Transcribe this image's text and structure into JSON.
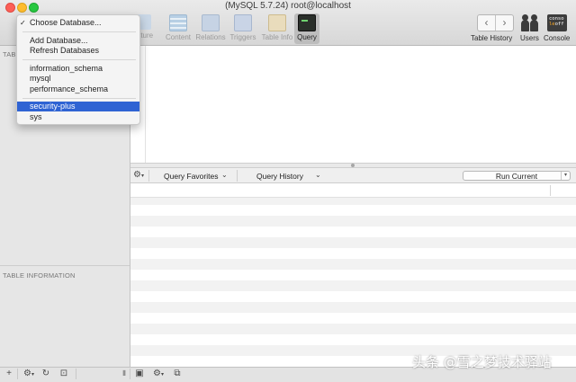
{
  "window": {
    "title": "(MySQL 5.7.24) root@localhost"
  },
  "toolbar": {
    "items": [
      {
        "label": "Structure",
        "visible_label": "ucture",
        "icon": "structure-icon",
        "active": false
      },
      {
        "label": "Content",
        "icon": "content-icon",
        "active": false
      },
      {
        "label": "Relations",
        "icon": "relations-icon",
        "active": false
      },
      {
        "label": "Triggers",
        "icon": "triggers-icon",
        "active": false
      },
      {
        "label": "Table Info",
        "icon": "table-info-icon",
        "active": false
      },
      {
        "label": "Query",
        "icon": "query-icon",
        "active": true
      }
    ],
    "history_label": "Table History",
    "users_label": "Users",
    "console_label": "Console",
    "console_icon_text": [
      "conso",
      "le",
      "off"
    ]
  },
  "sidebar": {
    "tables_header": "TABLE",
    "table_info_header": "TABLE INFORMATION"
  },
  "db_menu": {
    "choose": "Choose Database...",
    "add": "Add Database...",
    "refresh": "Refresh Databases",
    "databases": [
      "information_schema",
      "mysql",
      "performance_schema"
    ],
    "user_databases": [
      "security-plus",
      "sys"
    ],
    "selected": "security-plus",
    "check_glyph": "✓"
  },
  "query_bar": {
    "favorites": "Query Favorites",
    "history": "Query History",
    "run": "Run Current",
    "chevron": "⌄"
  },
  "watermark": "头条 @雪之梦技术驿站",
  "colors": {
    "selection": "#2f63d3",
    "window_bg": "#ececec"
  }
}
